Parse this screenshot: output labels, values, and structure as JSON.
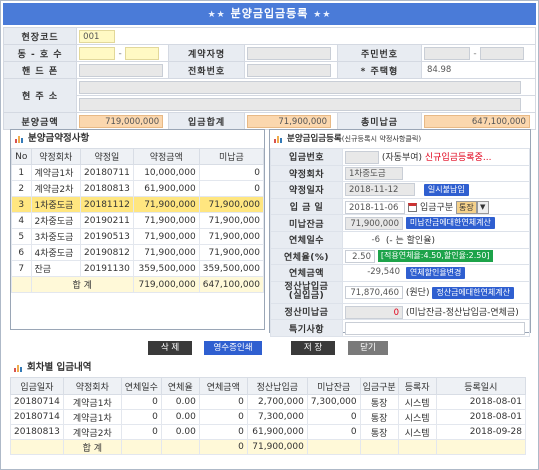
{
  "window": {
    "title": "분양금입금등록"
  },
  "header": {
    "site_code_label": "현장코드",
    "site_code": "001",
    "unit_label": "동 - 호 수",
    "contractor_label": "계약자명",
    "resident_no_label": "주민번호",
    "cellphone_label": "핸 드 폰",
    "phone_label": "전화번호",
    "unit_type_label": "* 주택형",
    "unit_type_value": "84.98",
    "address_label": "현 주 소",
    "sale_price_label": "분양금액",
    "sale_price": "719,000,000",
    "paid_total_label": "입금합계",
    "paid_total": "71,900,000",
    "unpaid_total_label": "총미납금",
    "unpaid_total": "647,100,000"
  },
  "schedule": {
    "title": "분양금약정사항",
    "columns": [
      "No",
      "약정회차",
      "약정일",
      "약정금액",
      "미납금"
    ],
    "rows": [
      [
        "1",
        "계약금1차",
        "20180711",
        "10,000,000",
        "0"
      ],
      [
        "2",
        "계약금2차",
        "20180813",
        "61,900,000",
        "0"
      ],
      [
        "3",
        "1차중도금",
        "20181112",
        "71,900,000",
        "71,900,000"
      ],
      [
        "4",
        "2차중도금",
        "20190211",
        "71,900,000",
        "71,900,000"
      ],
      [
        "5",
        "3차중도금",
        "20190513",
        "71,900,000",
        "71,900,000"
      ],
      [
        "6",
        "4차중도금",
        "20190812",
        "71,900,000",
        "71,900,000"
      ],
      [
        "7",
        "잔금",
        "20191130",
        "359,500,000",
        "359,500,000"
      ]
    ],
    "sum_label": "합 계",
    "sum_amount": "719,000,000",
    "sum_unpaid": "647,100,000"
  },
  "payment_form": {
    "title": "분양금입금등록",
    "subtitle": "(신규등록시 약정사항클릭)",
    "payment_no_label": "입금번호",
    "payment_no_auto": "(자동부여)",
    "payment_no_note": "신규입금등록중...",
    "round_label": "약정회차",
    "round_value": "1차중도금",
    "due_date_label": "약정일자",
    "due_date_value": "2018-11-12",
    "prepay_btn": "일시불납입",
    "pay_date_label": "입 금 일",
    "pay_date_value": "2018-11-06",
    "pay_type_label": "입금구분",
    "pay_type_value": "통장",
    "unpaid_label": "미납잔금",
    "unpaid_value": "71,900,000",
    "unpaid_btn": "미납잔금에대한연체계산",
    "overdue_days_label": "연체일수",
    "overdue_days_value": "-6",
    "overdue_days_note": "(- 는 할인율)",
    "rate_label": "연체율(%)",
    "rate_value": "2.50",
    "rate_note": "[적용연체율:4.50,할인율:2.50]",
    "overdue_amt_label": "연체금액",
    "overdue_amt_value": "-29,540",
    "overdue_amt_btn": "연체할인율변경",
    "settle_label": "정산납입금\n(실입금)",
    "settle_value": "71,870,460",
    "settle_unit": "(원단)",
    "settle_btn": "정산금에대한연체계산",
    "settle_unpaid_label": "정산미납금",
    "settle_unpaid_value": "0",
    "settle_unpaid_note": "(미납잔금-정산납입금-연체금)",
    "memo_label": "특기사항"
  },
  "actions": {
    "delete": "삭 제",
    "receipt": "영수증인쇄",
    "save": "저 장",
    "close": "닫기"
  },
  "history": {
    "title": "회차별 입금내역",
    "columns": [
      "입금일자",
      "약정회차",
      "연체일수",
      "연체율",
      "연체금액",
      "정산납입금",
      "미납잔금",
      "입금구분",
      "등록자",
      "등록일시"
    ],
    "rows": [
      [
        "20180714",
        "계약금1차",
        "0",
        "0.00",
        "0",
        "2,700,000",
        "7,300,000",
        "통장",
        "시스템",
        "2018-08-01"
      ],
      [
        "20180714",
        "계약금1차",
        "0",
        "0.00",
        "0",
        "7,300,000",
        "0",
        "통장",
        "시스템",
        "2018-08-01"
      ],
      [
        "20180813",
        "계약금2차",
        "0",
        "0.00",
        "0",
        "61,900,000",
        "0",
        "통장",
        "시스템",
        "2018-09-28"
      ]
    ],
    "sum_label": "합 계",
    "sum_overdue": "0",
    "sum_settle": "71,900,000"
  },
  "colors": {
    "title_bg": "#4a7bd8",
    "selected_row": "#ffe680",
    "amount_bg": "#fbd7ae",
    "required_bg": "#fff9c4"
  }
}
